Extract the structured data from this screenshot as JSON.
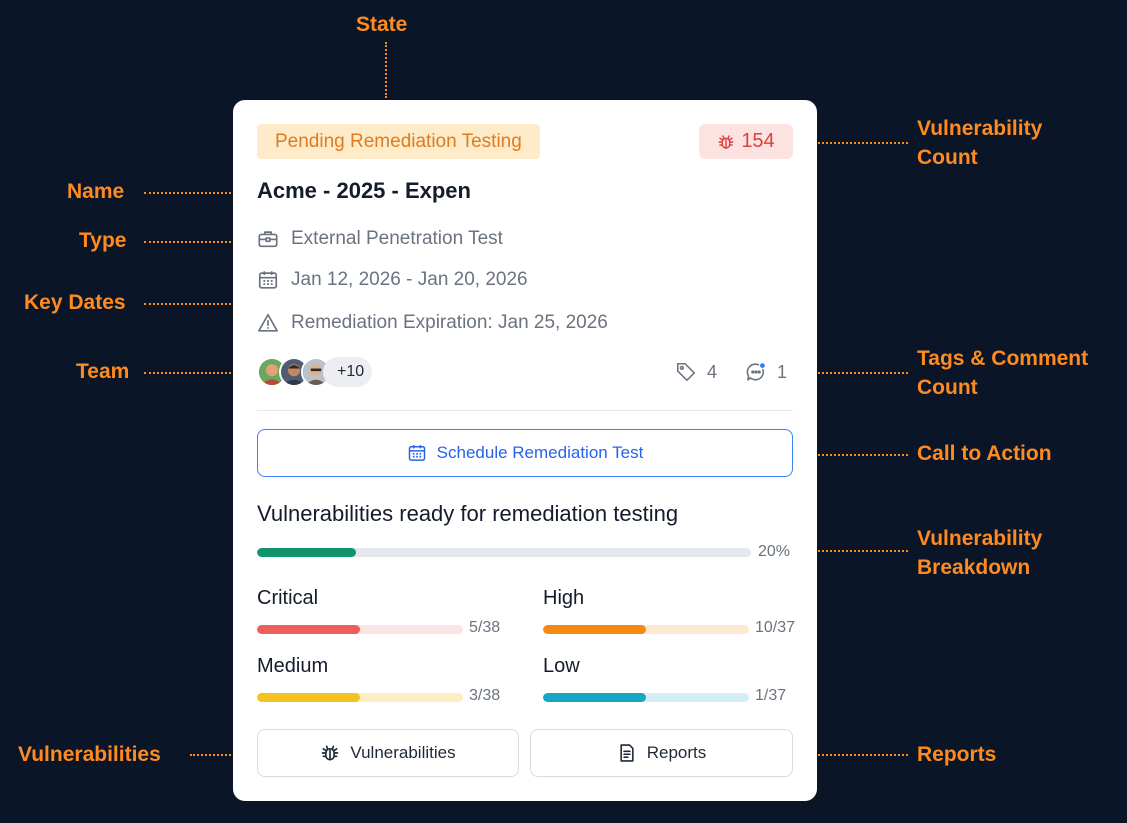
{
  "annotations": {
    "state": "State",
    "vuln_count_1": "Vulnerability",
    "vuln_count_2": "Count",
    "name": "Name",
    "type": "Type",
    "key_dates": "Key Dates",
    "team": "Team",
    "tags_comment_1": "Tags & Comment",
    "tags_comment_2": "Count",
    "cta": "Call to Action",
    "breakdown_1": "Vulnerability",
    "breakdown_2": "Breakdown",
    "vulnerabilities": "Vulnerabilities",
    "reports": "Reports"
  },
  "card": {
    "state": "Pending Remediation Testing",
    "vulnerability_count": "154",
    "name": "Acme - 2025 - Expen",
    "type": "External Penetration Test",
    "dates": "Jan 12, 2026 - Jan 20, 2026",
    "expiration": "Remediation Expiration: Jan 25, 2026",
    "team_more": "+10",
    "tags_count": "4",
    "comment_count": "1",
    "cta_label": "Schedule Remediation Test",
    "ready_title": "Vulnerabilities ready for remediation testing",
    "ready_percent": "20%",
    "ready_fraction": 0.2,
    "severities": [
      {
        "label": "Critical",
        "count": "5/38",
        "fraction": 0.5,
        "fill": "#ec5f5b",
        "track": "#fbe4e3"
      },
      {
        "label": "High",
        "count": "10/37",
        "fraction": 0.5,
        "fill": "#f58a12",
        "track": "#fde9cf"
      },
      {
        "label": "Medium",
        "count": "3/38",
        "fraction": 0.5,
        "fill": "#f4c320",
        "track": "#fdefc3"
      },
      {
        "label": "Low",
        "count": "1/37",
        "fraction": 0.5,
        "fill": "#17a7c3",
        "track": "#d4eff4"
      }
    ],
    "vulnerabilities_button": "Vulnerabilities",
    "reports_button": "Reports"
  },
  "colors": {
    "background": "#0a1628",
    "annotation": "#ff8a1f",
    "ready_fill": "#11946b",
    "ready_track": "#e4e8ee"
  },
  "icons": {
    "vuln_count": "bug-icon",
    "type": "briefcase-icon",
    "dates": "calendar-icon",
    "expiration": "warning-icon",
    "tags": "tag-icon",
    "comments": "comment-icon",
    "cta": "calendar-icon",
    "vulnerabilities": "bug-icon",
    "reports": "document-icon"
  }
}
